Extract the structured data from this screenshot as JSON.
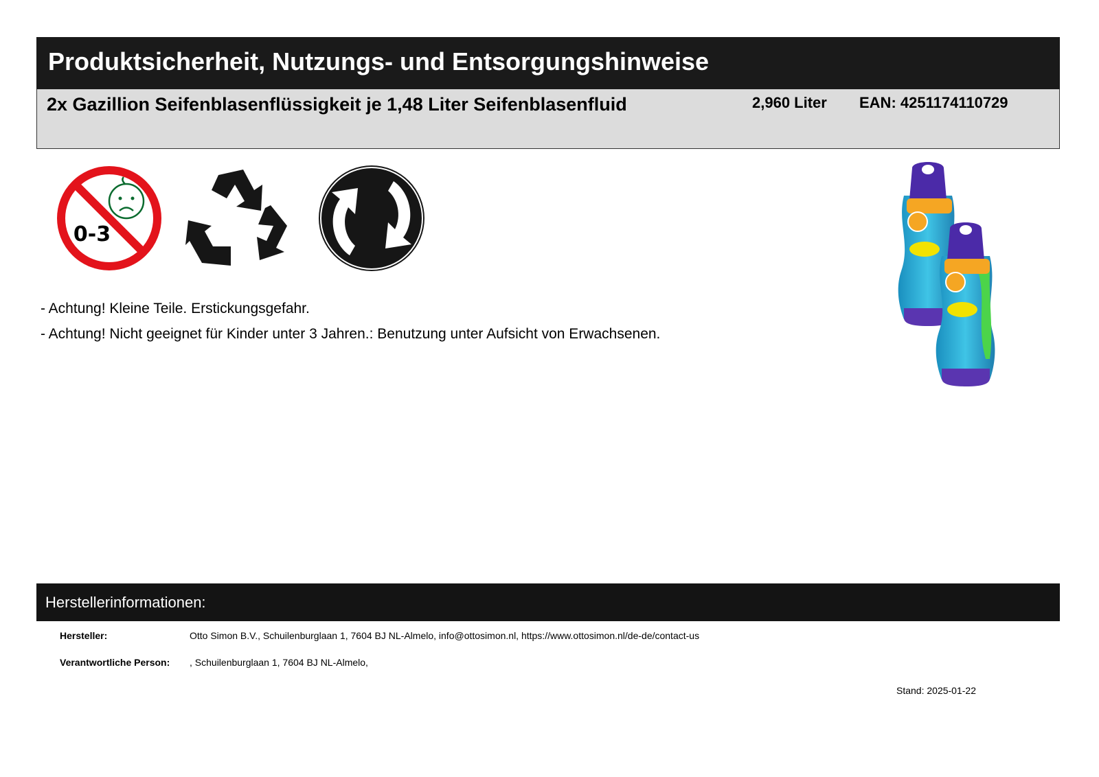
{
  "header": {
    "title": "Produktsicherheit, Nutzungs- und Entsorgungshinweise"
  },
  "product": {
    "name": "2x Gazillion Seifenblasenflüssigkeit je 1,48 Liter Seifenblasenfluid",
    "volume": "2,960 Liter",
    "ean": "EAN: 4251174110729"
  },
  "symbols": {
    "age_warning": {
      "icon": "age-0-3-prohibited-icon",
      "label": "0-3",
      "ring_color": "#e3131b",
      "face_color": "#0a6b2e"
    },
    "recycling": {
      "icon": "recycling-icon"
    },
    "green_dot": {
      "icon": "green-dot-icon"
    }
  },
  "product_image": {
    "icon": "product-bottles-image"
  },
  "warnings": [
    "- Achtung! Kleine Teile. Erstickungsgefahr.",
    "- Achtung! Nicht geeignet für Kinder unter 3 Jahren.: Benutzung unter Aufsicht von Erwachsenen."
  ],
  "manufacturer": {
    "section_title": "Herstellerinformationen:",
    "rows": [
      {
        "label": "Hersteller:",
        "value": "Otto Simon B.V., Schuilenburglaan 1, 7604 BJ NL-Almelo, info@ottosimon.nl, https://www.ottosimon.nl/de-de/contact-us"
      },
      {
        "label": "Verantwortliche Person:",
        "value": ", Schuilenburglaan 1, 7604 BJ NL-Almelo,"
      }
    ]
  },
  "footer": {
    "stand": "Stand: 2025-01-22"
  }
}
